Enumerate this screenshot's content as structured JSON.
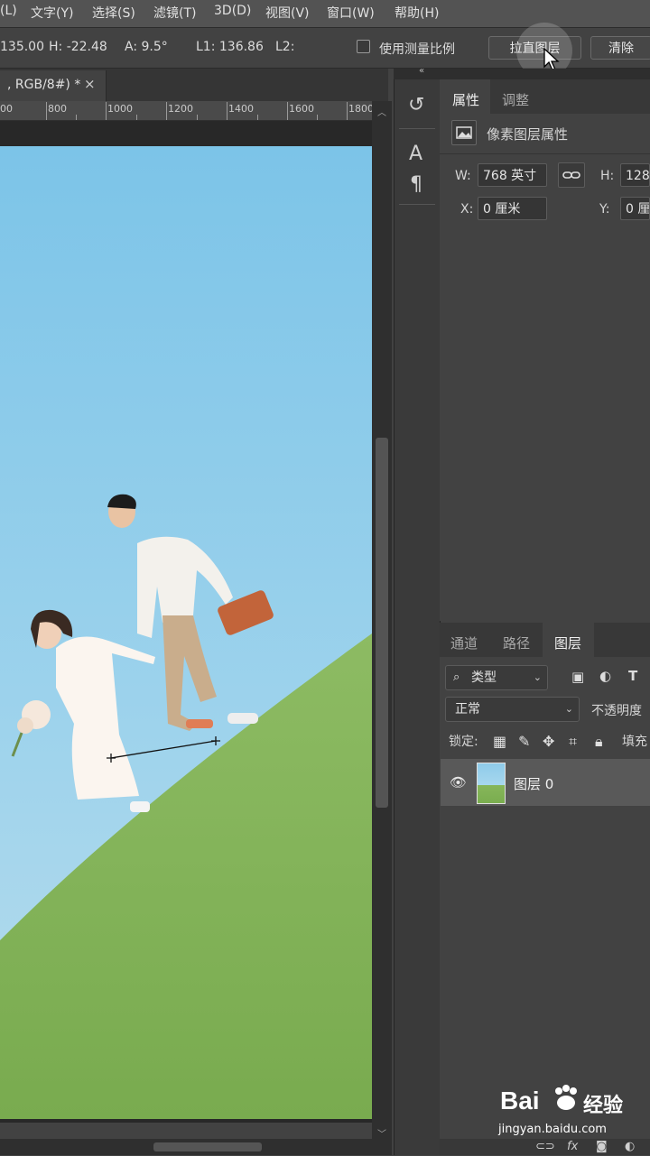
{
  "menu": [
    "(L)",
    "文字(Y)",
    "选择(S)",
    "滤镜(T)",
    "3D(D)",
    "视图(V)",
    "窗口(W)",
    "帮助(H)"
  ],
  "options": {
    "x_value": "135.00",
    "h_value": "H: -22.48",
    "angle_value": "A: 9.5°",
    "l1_value": "L1: 136.86",
    "l2_label": "L2:",
    "use_measure_scale": "使用测量比例",
    "straighten_button": "拉直图层",
    "clear_button": "清除"
  },
  "document": {
    "tab_title": ", RGB/8#) *",
    "tab_close": "×",
    "ruler_labels": [
      "00",
      "800",
      "1000",
      "1200",
      "1400",
      "1600",
      "1800"
    ]
  },
  "properties": {
    "tabs": [
      "属性",
      "调整"
    ],
    "header": "像素图层属性",
    "w_label": "W:",
    "w_value": "768 英寸",
    "h_label": "H:",
    "h_value": "128",
    "x_label": "X:",
    "x_value": "0 厘米",
    "y_label": "Y:",
    "y_value": "0 厘"
  },
  "layers": {
    "tabs": [
      "通道",
      "路径",
      "图层"
    ],
    "filter_kind": "类型",
    "blend_mode": "正常",
    "opacity_label": "不透明度",
    "lock_label": "锁定:",
    "fill_label": "填充",
    "layer_name": "图层 0"
  },
  "watermark": {
    "brand": "Bai",
    "brand_suffix": "经验",
    "url": "jingyan.baidu.com"
  }
}
